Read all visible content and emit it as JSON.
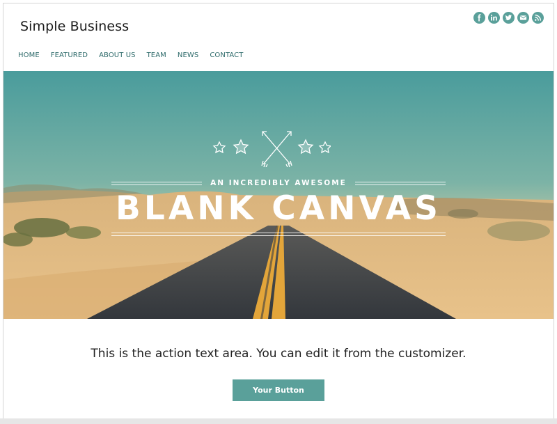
{
  "site": {
    "title": "Simple Business"
  },
  "social": [
    {
      "name": "facebook-icon",
      "glyph": "f"
    },
    {
      "name": "linkedin-icon",
      "glyph": "in"
    },
    {
      "name": "twitter-icon",
      "glyph": "t"
    },
    {
      "name": "email-icon",
      "glyph": "mail"
    },
    {
      "name": "rss-icon",
      "glyph": "rss"
    }
  ],
  "nav": [
    "HOME",
    "FEATURED",
    "ABOUT US",
    "TEAM",
    "NEWS",
    "CONTACT"
  ],
  "hero": {
    "tagline": "AN INCREDIBLY AWESOME",
    "title": "BLANK CANVAS"
  },
  "action": {
    "text": "This is the action text area. You can edit it from the customizer.",
    "button_label": "Your Button"
  },
  "colors": {
    "accent": "#5aa09a",
    "nav_text": "#2d6a6a",
    "sky_top": "#4a9c9c",
    "sand": "#e2b878",
    "road": "#3a3d42"
  }
}
